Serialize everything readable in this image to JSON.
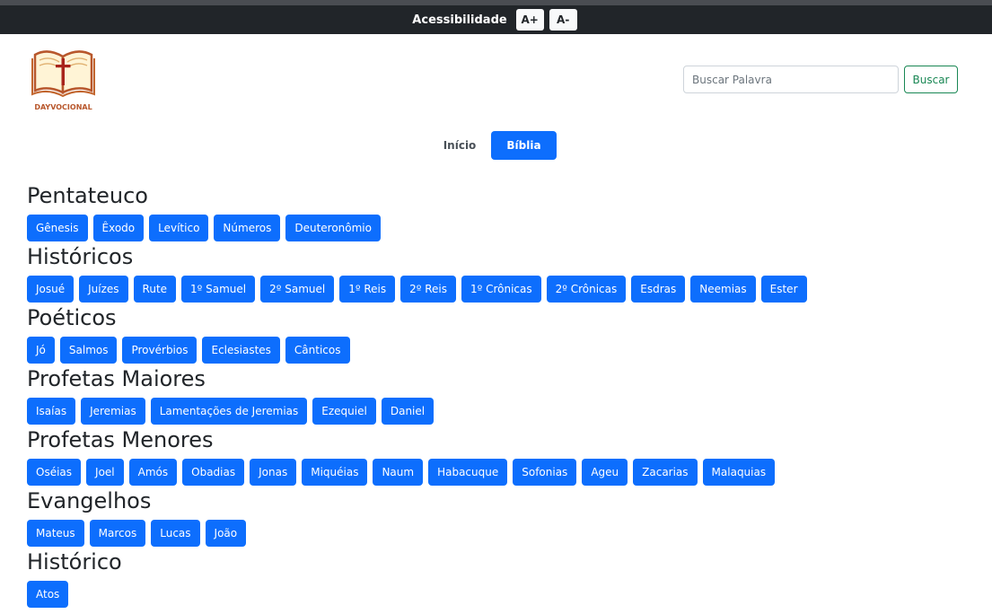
{
  "accessibility": {
    "label": "Acessibilidade",
    "increase_label": "A+",
    "decrease_label": "A-"
  },
  "logo": {
    "text": "DAYVOCIONAL",
    "icon": "open-bible-cross-icon"
  },
  "search": {
    "placeholder": "Buscar Palavra",
    "value": "",
    "button_label": "Buscar"
  },
  "nav": {
    "home_label": "Início",
    "bible_label": "Bíblia"
  },
  "colors": {
    "primary": "#0d6efd",
    "success": "#198754",
    "dark": "#212529",
    "logo_brown": "#b8572c"
  },
  "sections": [
    {
      "title": "Pentateuco",
      "books": [
        "Gênesis",
        "Êxodo",
        "Levítico",
        "Números",
        "Deuteronômio"
      ]
    },
    {
      "title": "Históricos",
      "books": [
        "Josué",
        "Juízes",
        "Rute",
        "1º Samuel",
        "2º Samuel",
        "1º Reis",
        "2º Reis",
        "1º Crônicas",
        "2º Crônicas",
        "Esdras",
        "Neemias",
        "Ester"
      ]
    },
    {
      "title": "Poéticos",
      "books": [
        "Jó",
        "Salmos",
        "Provérbios",
        "Eclesiastes",
        "Cânticos"
      ]
    },
    {
      "title": "Profetas Maiores",
      "books": [
        "Isaías",
        "Jeremias",
        "Lamentações de Jeremias",
        "Ezequiel",
        "Daniel"
      ]
    },
    {
      "title": "Profetas Menores",
      "books": [
        "Oséias",
        "Joel",
        "Amós",
        "Obadias",
        "Jonas",
        "Miquéias",
        "Naum",
        "Habacuque",
        "Sofonias",
        "Ageu",
        "Zacarias",
        "Malaquias"
      ]
    },
    {
      "title": "Evangelhos",
      "books": [
        "Mateus",
        "Marcos",
        "Lucas",
        "João"
      ]
    },
    {
      "title": "Histórico",
      "books": [
        "Atos"
      ]
    }
  ]
}
